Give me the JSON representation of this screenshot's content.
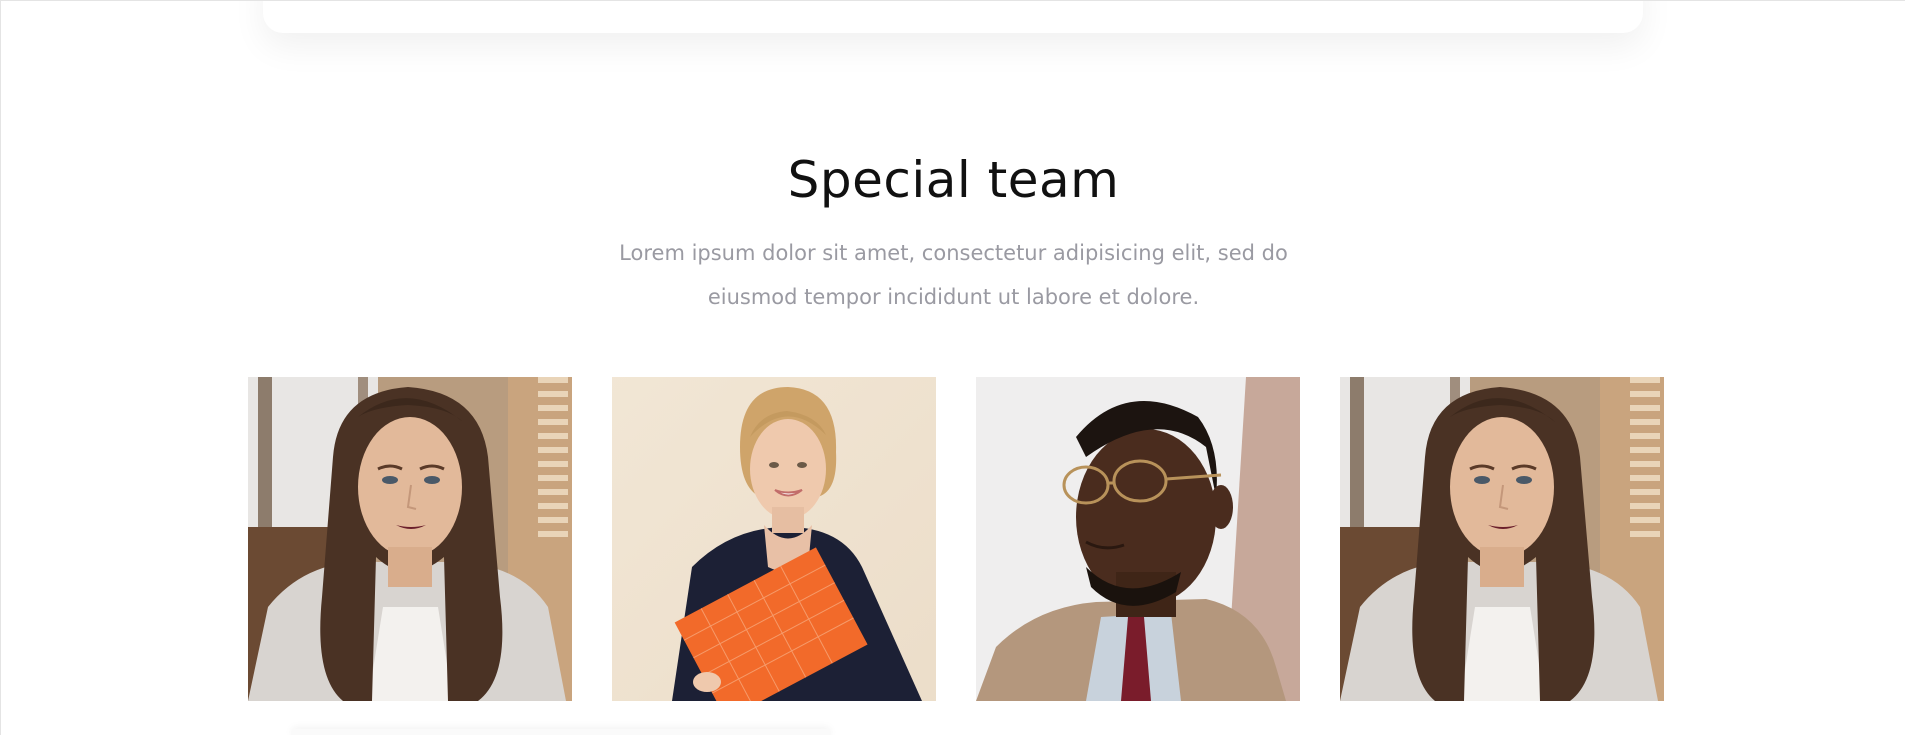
{
  "section": {
    "title": "Special team",
    "subtitle": "Lorem ipsum dolor sit amet, consectetur adipisicing elit, sed do eiusmod tempor incididunt ut labore et dolore."
  },
  "team": [
    {
      "photo": "woman-brown-hair-portrait",
      "background": "#b69a7c"
    },
    {
      "photo": "woman-blonde-orange-folder-portrait",
      "background": "#efe2cf"
    },
    {
      "photo": "man-glasses-suit-portrait",
      "background": "#eeeeee"
    },
    {
      "photo": "woman-brown-hair-portrait",
      "background": "#b69a7c"
    }
  ]
}
